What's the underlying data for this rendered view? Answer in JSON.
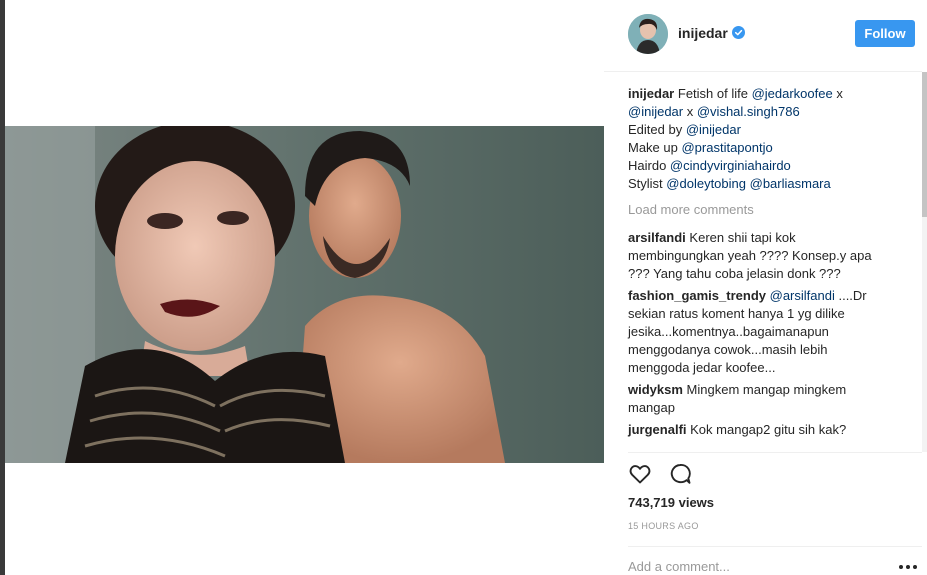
{
  "post": {
    "username": "inijedar",
    "follow_label": "Follow",
    "caption": {
      "author": "inijedar",
      "lines": [
        [
          {
            "t": "txt",
            "v": "Fetish of life "
          },
          {
            "t": "mention",
            "v": "@jedarkoofee"
          },
          {
            "t": "txt",
            "v": " x"
          }
        ],
        [
          {
            "t": "mention",
            "v": "@inijedar"
          },
          {
            "t": "txt",
            "v": " x "
          },
          {
            "t": "mention",
            "v": "@vishal.singh786"
          }
        ],
        [
          {
            "t": "txt",
            "v": "Edited by "
          },
          {
            "t": "mention",
            "v": "@inijedar"
          }
        ],
        [
          {
            "t": "txt",
            "v": "Make up "
          },
          {
            "t": "mention",
            "v": "@prastitapontjo"
          }
        ],
        [
          {
            "t": "txt",
            "v": "Hairdo "
          },
          {
            "t": "mention",
            "v": "@cindyvirginiahairdo"
          }
        ],
        [
          {
            "t": "txt",
            "v": "Stylist "
          },
          {
            "t": "mention",
            "v": "@doleytobing"
          },
          {
            "t": "txt",
            "v": " "
          },
          {
            "t": "mention",
            "v": "@barliasmara"
          }
        ]
      ]
    },
    "load_more_label": "Load more comments",
    "comments": [
      {
        "author": "arsilfandi",
        "lines": [
          [
            {
              "t": "txt",
              "v": "Keren shii tapi kok"
            }
          ],
          [
            {
              "t": "txt",
              "v": "membingungkan yeah ???? Konsep.y apa"
            }
          ],
          [
            {
              "t": "txt",
              "v": "??? Yang tahu coba jelasin donk ???"
            }
          ]
        ]
      },
      {
        "author": "fashion_gamis_trendy",
        "lines": [
          [
            {
              "t": "txt",
              "v": " "
            },
            {
              "t": "mention",
              "v": "@arsilfandi"
            },
            {
              "t": "txt",
              "v": " ....Dr"
            }
          ],
          [
            {
              "t": "txt",
              "v": "sekian ratus koment hanya 1 yg dilike"
            }
          ],
          [
            {
              "t": "txt",
              "v": "jesika...komentnya..bagaimanapun"
            }
          ],
          [
            {
              "t": "txt",
              "v": "menggodanya cowok...masih lebih"
            }
          ],
          [
            {
              "t": "txt",
              "v": "menggoda jedar koofee..."
            }
          ]
        ]
      },
      {
        "author": "widyksm",
        "lines": [
          [
            {
              "t": "txt",
              "v": "Mingkem mangap mingkem"
            }
          ],
          [
            {
              "t": "txt",
              "v": "mangap"
            }
          ]
        ]
      },
      {
        "author": "jurgenalfi",
        "lines": [
          [
            {
              "t": "txt",
              "v": "Kok mangap2 gitu sih kak?"
            }
          ]
        ]
      }
    ],
    "views": "743,719 views",
    "time_ago": "15 hours ago",
    "add_comment_placeholder": "Add a comment...",
    "icons": {
      "like": "heart-outline-icon",
      "comment": "speech-bubble-icon",
      "verified": "verified-badge-icon",
      "options": "more-dots-icon"
    },
    "colors": {
      "follow_button": "#3897f0",
      "mention": "#003569",
      "verified": "#3897f0",
      "muted": "#999999"
    }
  }
}
